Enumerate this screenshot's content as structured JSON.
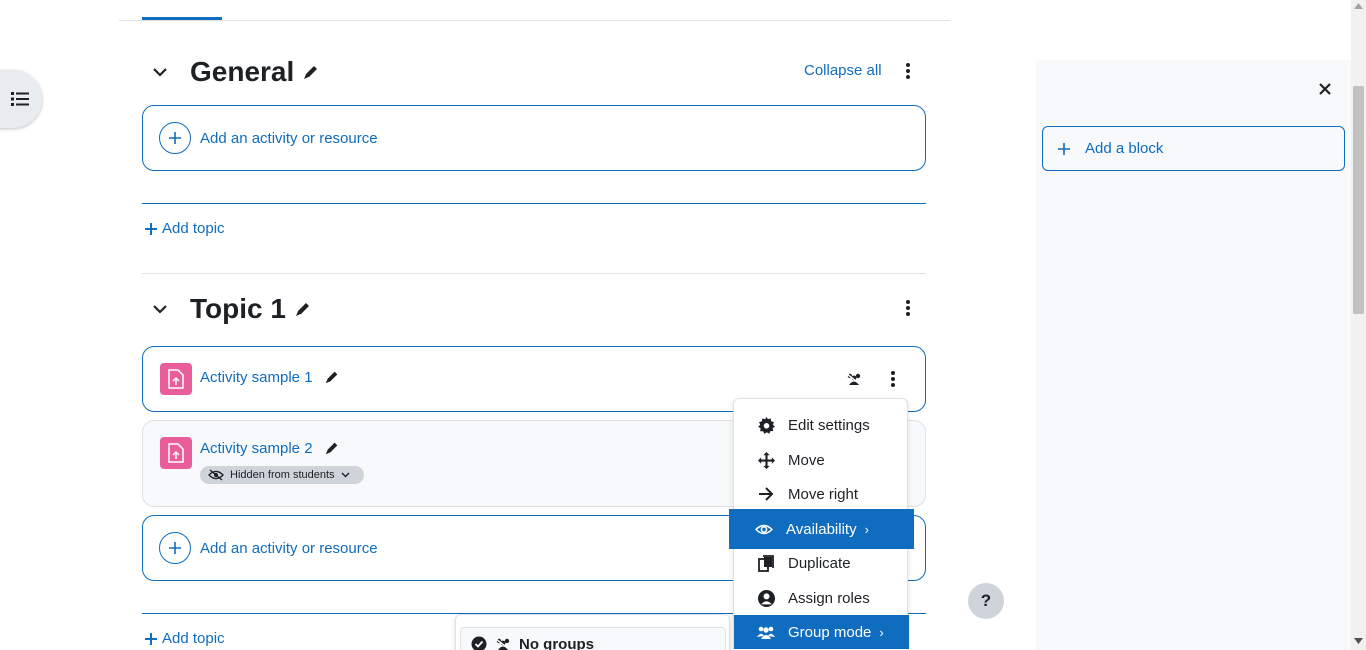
{
  "colors": {
    "accent": "#0f6cbf",
    "activity_icon": "#e85d9a",
    "drawer_bg": "#f8f9fa"
  },
  "course_index": {
    "icon": "list-icon"
  },
  "general_section": {
    "title": "General",
    "collapse_all": "Collapse all",
    "add_activity": "Add an activity or resource"
  },
  "add_topic_label": "Add topic",
  "topic1": {
    "title": "Topic 1",
    "activities": [
      {
        "title": "Activity sample 1",
        "icon": "assignment-icon"
      },
      {
        "title": "Activity sample 2",
        "icon": "assignment-icon",
        "badge": "Hidden from students"
      }
    ],
    "add_activity": "Add an activity or resource"
  },
  "action_menu": {
    "items": [
      {
        "label": "Edit settings",
        "icon": "gear-icon"
      },
      {
        "label": "Move",
        "icon": "move-icon"
      },
      {
        "label": "Move right",
        "icon": "arrow-right-icon"
      },
      {
        "label": "Availability",
        "icon": "eye-icon"
      },
      {
        "label": "Duplicate",
        "icon": "copy-icon"
      },
      {
        "label": "Assign roles",
        "icon": "user-circle-icon"
      },
      {
        "label": "Group mode",
        "icon": "group-icon"
      }
    ]
  },
  "group_submenu": {
    "selected": "No groups"
  },
  "help_label": "?",
  "block_drawer": {
    "add_block": "Add a block"
  }
}
